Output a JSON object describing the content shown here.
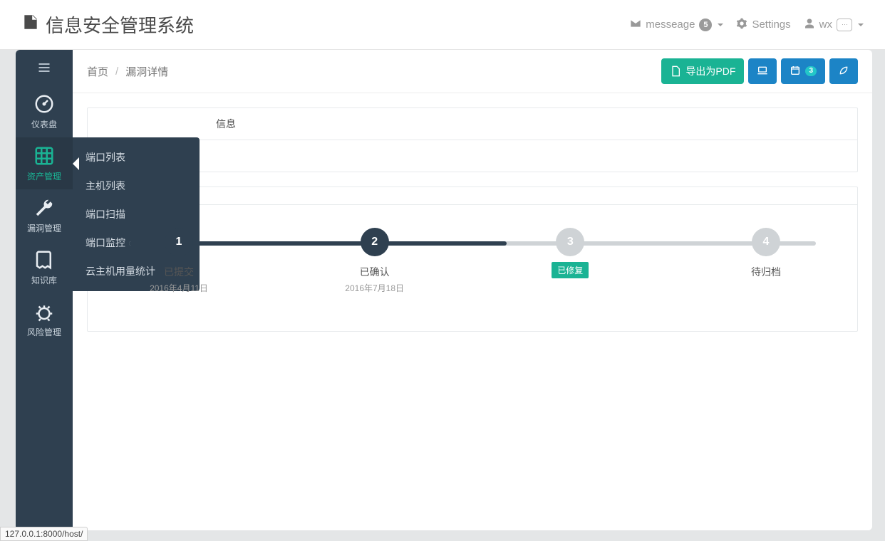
{
  "header": {
    "app_title": "信息安全管理系统",
    "message_label": "messeage",
    "message_count": "5",
    "settings_label": "Settings",
    "username": "wx"
  },
  "sidebar": {
    "items": [
      {
        "label": "仪表盘",
        "icon": "dashboard-icon"
      },
      {
        "label": "资产管理",
        "icon": "grid-icon",
        "active": true
      },
      {
        "label": "漏洞管理",
        "icon": "wrench-icon"
      },
      {
        "label": "知识库",
        "icon": "book-icon"
      },
      {
        "label": "风险管理",
        "icon": "bug-icon"
      }
    ],
    "submenu": [
      "端口列表",
      "主机列表",
      "端口扫描",
      "端口监控",
      "云主机用量统计"
    ]
  },
  "breadcrumb": {
    "home": "首页",
    "current": "漏洞详情"
  },
  "toolbar": {
    "export_pdf": "导出为PDF",
    "calendar_badge": "3"
  },
  "panel1": {
    "title_fragment": "信息"
  },
  "panel2": {
    "title": ""
  },
  "steps": {
    "items": [
      {
        "num": "1",
        "title": "已提交",
        "date": "2016年4月11日",
        "state": "done"
      },
      {
        "num": "2",
        "title": "已确认",
        "date": "2016年7月18日",
        "state": "done"
      },
      {
        "num": "3",
        "title": "",
        "date": "",
        "tag": "已修复",
        "state": "current"
      },
      {
        "num": "4",
        "title": "待归档",
        "date": "",
        "state": "pending"
      }
    ],
    "progress_pct": 55
  },
  "status_url": "127.0.0.1:8000/host/"
}
